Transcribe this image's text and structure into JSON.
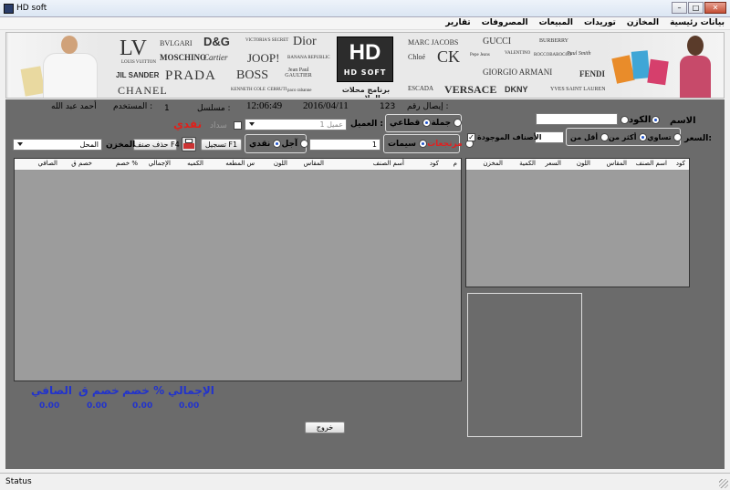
{
  "window": {
    "title": "HD soft",
    "buttons": [
      "–",
      "□",
      "✕"
    ]
  },
  "menu": [
    "بيانات رئيسية",
    "المخازن",
    "توريدات",
    "المبيعات",
    "المصروفات",
    "تقارير"
  ],
  "banner": {
    "brands": [
      "BVLGARI",
      "D&G",
      "VICTORIA'S SECRET",
      "Dior",
      "MARC JACOBS",
      "GUCCI",
      "BURBERRY",
      "MOSCHINO",
      "Cartier",
      "JOOP!",
      "BANANA REPUBLIC",
      "Chloé",
      "CK",
      "Pepe Jeans",
      "VALENTINO",
      "ROCCOBAROCCO",
      "Paul Smith",
      "JIL SANDER",
      "PRADA",
      "BOSS",
      "Jean Paul GAULTIER",
      "GIORGIO ARMANI",
      "FENDI",
      "CHANEL",
      "ESCADA",
      "VERSACE",
      "DKNY",
      "YVES SAINT LAURENT",
      "LV",
      "LOUIS VUITTON",
      "paco rabanne",
      "KENNETH COLE",
      "CERRUTI"
    ],
    "logo_hd": "HD",
    "logo_soft": "HD SOFT",
    "tagline": "برنامج محلات الملابس"
  },
  "header": {
    "invoice_label": "إيصال رقم :",
    "invoice_value": "123",
    "date": "2016/04/11",
    "time": "12:06:49",
    "serial_label": "مسلسل :",
    "serial_value": "1",
    "user_label": "المستخدم :",
    "user_value": "أحمد عبد الله"
  },
  "sale": {
    "customer_label": "العميل :",
    "customer_value": "عميل 1",
    "paid_label": "سداد",
    "cash_red": "نقدي",
    "type_options": [
      {
        "label": "قطاعي",
        "selected": false
      },
      {
        "label": "جملة",
        "selected": true
      }
    ],
    "cat_options": [
      {
        "label": "سيمات",
        "selected": false
      },
      {
        "label": "مرتجعات",
        "selected": true
      }
    ],
    "pay_options": [
      {
        "label": "نقدي",
        "selected": true
      },
      {
        "label": "آجل",
        "selected": false
      }
    ],
    "qty_value": "1",
    "register_btn": "تسجيل F1",
    "delete_btn": "حذف صنف F4",
    "store_label": "المخزن",
    "store_value": "المحل"
  },
  "table": {
    "columns": [
      "م",
      "كود",
      "أسم الصنف",
      "المقاس",
      "اللون",
      "س المطعه",
      "الكميه",
      "الإجمالي",
      "خصم %",
      "خصم ق",
      "الصافي"
    ]
  },
  "totals": {
    "labels": [
      "الإجمالي",
      "خصم %",
      "خصم ق",
      "الصافي"
    ],
    "values": [
      "0.00",
      "0.00",
      "0.00",
      "0.00"
    ]
  },
  "exit_btn": "خروج",
  "search": {
    "name_label": "الاسم",
    "code_label": "الكود",
    "price_label": "السعر:",
    "price_options": [
      {
        "label": "أقل من",
        "selected": false
      },
      {
        "label": "أكثر من",
        "selected": true
      },
      {
        "label": "تساوي",
        "selected": false
      }
    ],
    "available_label": "الأصناف الموجودة",
    "available_checked": true
  },
  "side_table": {
    "columns": [
      "كود",
      "اسم الصنف",
      "المقاس",
      "اللون",
      "السعر",
      "الكمية",
      "المخزن"
    ]
  },
  "status": "Status"
}
